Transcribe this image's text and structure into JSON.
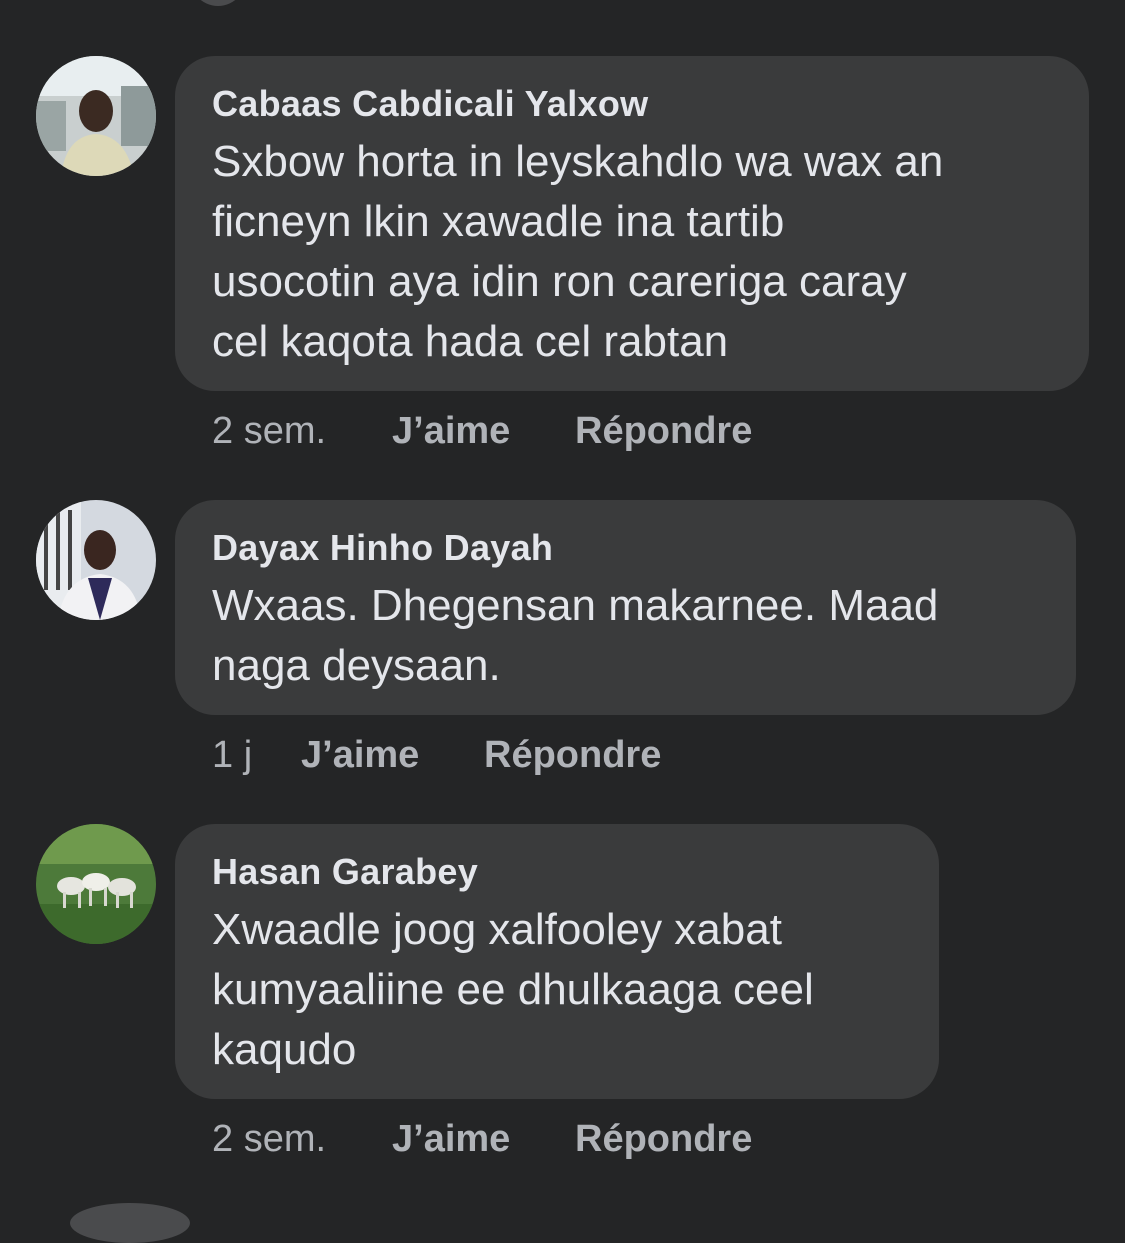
{
  "comments": [
    {
      "author": "Cabaas Cabdicali Yalxow",
      "text_lines": [
        "Sxbow horta in leyskahdlo wa wax an",
        "ficneyn lkin xawadle  ina tartib",
        "usocotin aya idin ron careriga caray",
        "cel kaqota hada cel rabtan"
      ],
      "time": "2 sem.",
      "like_label": "J’aime",
      "reply_label": "Répondre"
    },
    {
      "author": "Dayax Hinho Dayah",
      "text_lines": [
        "Wxaas. Dhegensan makarnee. Maad",
        "naga deysaan."
      ],
      "time": "1 j",
      "like_label": "J’aime",
      "reply_label": "Répondre"
    },
    {
      "author": "Hasan Garabey",
      "text_lines": [
        "Xwaadle joog xalfooley xabat",
        "kumyaaliine ee dhulkaaga ceel",
        "kaqudo"
      ],
      "time": "2 sem.",
      "like_label": "J’aime",
      "reply_label": "Répondre"
    }
  ],
  "colors": {
    "background": "#242526",
    "bubble": "#3a3b3c",
    "text": "#e4e6eb",
    "secondary": "#b0b3b8"
  }
}
